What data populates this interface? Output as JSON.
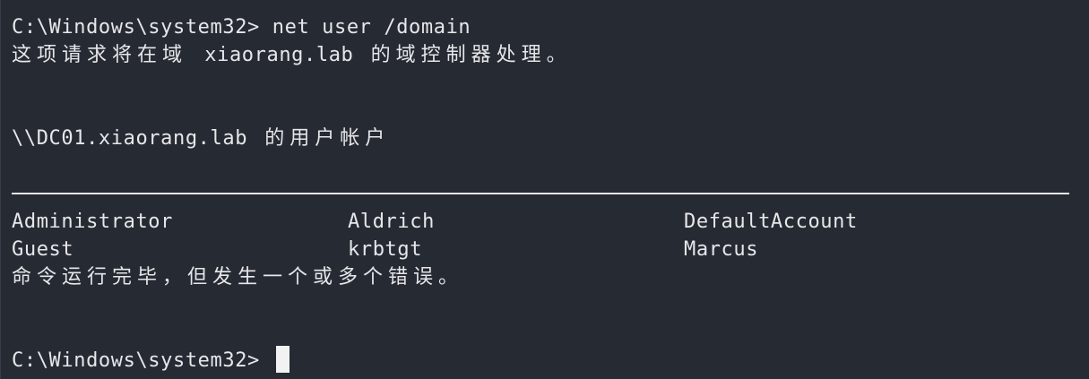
{
  "terminal": {
    "command_line": "C:\\Windows\\system32> net user /domain",
    "domain_msg_prefix": "这项请求将在域 ",
    "domain_name": "xiaorang.lab",
    "domain_msg_suffix": " 的域控制器处理。",
    "accounts_header_path": "\\\\DC01.xiaorang.lab",
    "accounts_header_suffix": " 的用户帐户",
    "accounts": [
      [
        "Administrator",
        "Aldrich",
        "DefaultAccount"
      ],
      [
        "Guest",
        "krbtgt",
        "Marcus"
      ]
    ],
    "completion_msg": "命令运行完毕，但发生一个或多个错误。",
    "prompt": "C:\\Windows\\system32> "
  },
  "colors": {
    "background": "#262a33",
    "foreground": "#e6e7e9"
  }
}
